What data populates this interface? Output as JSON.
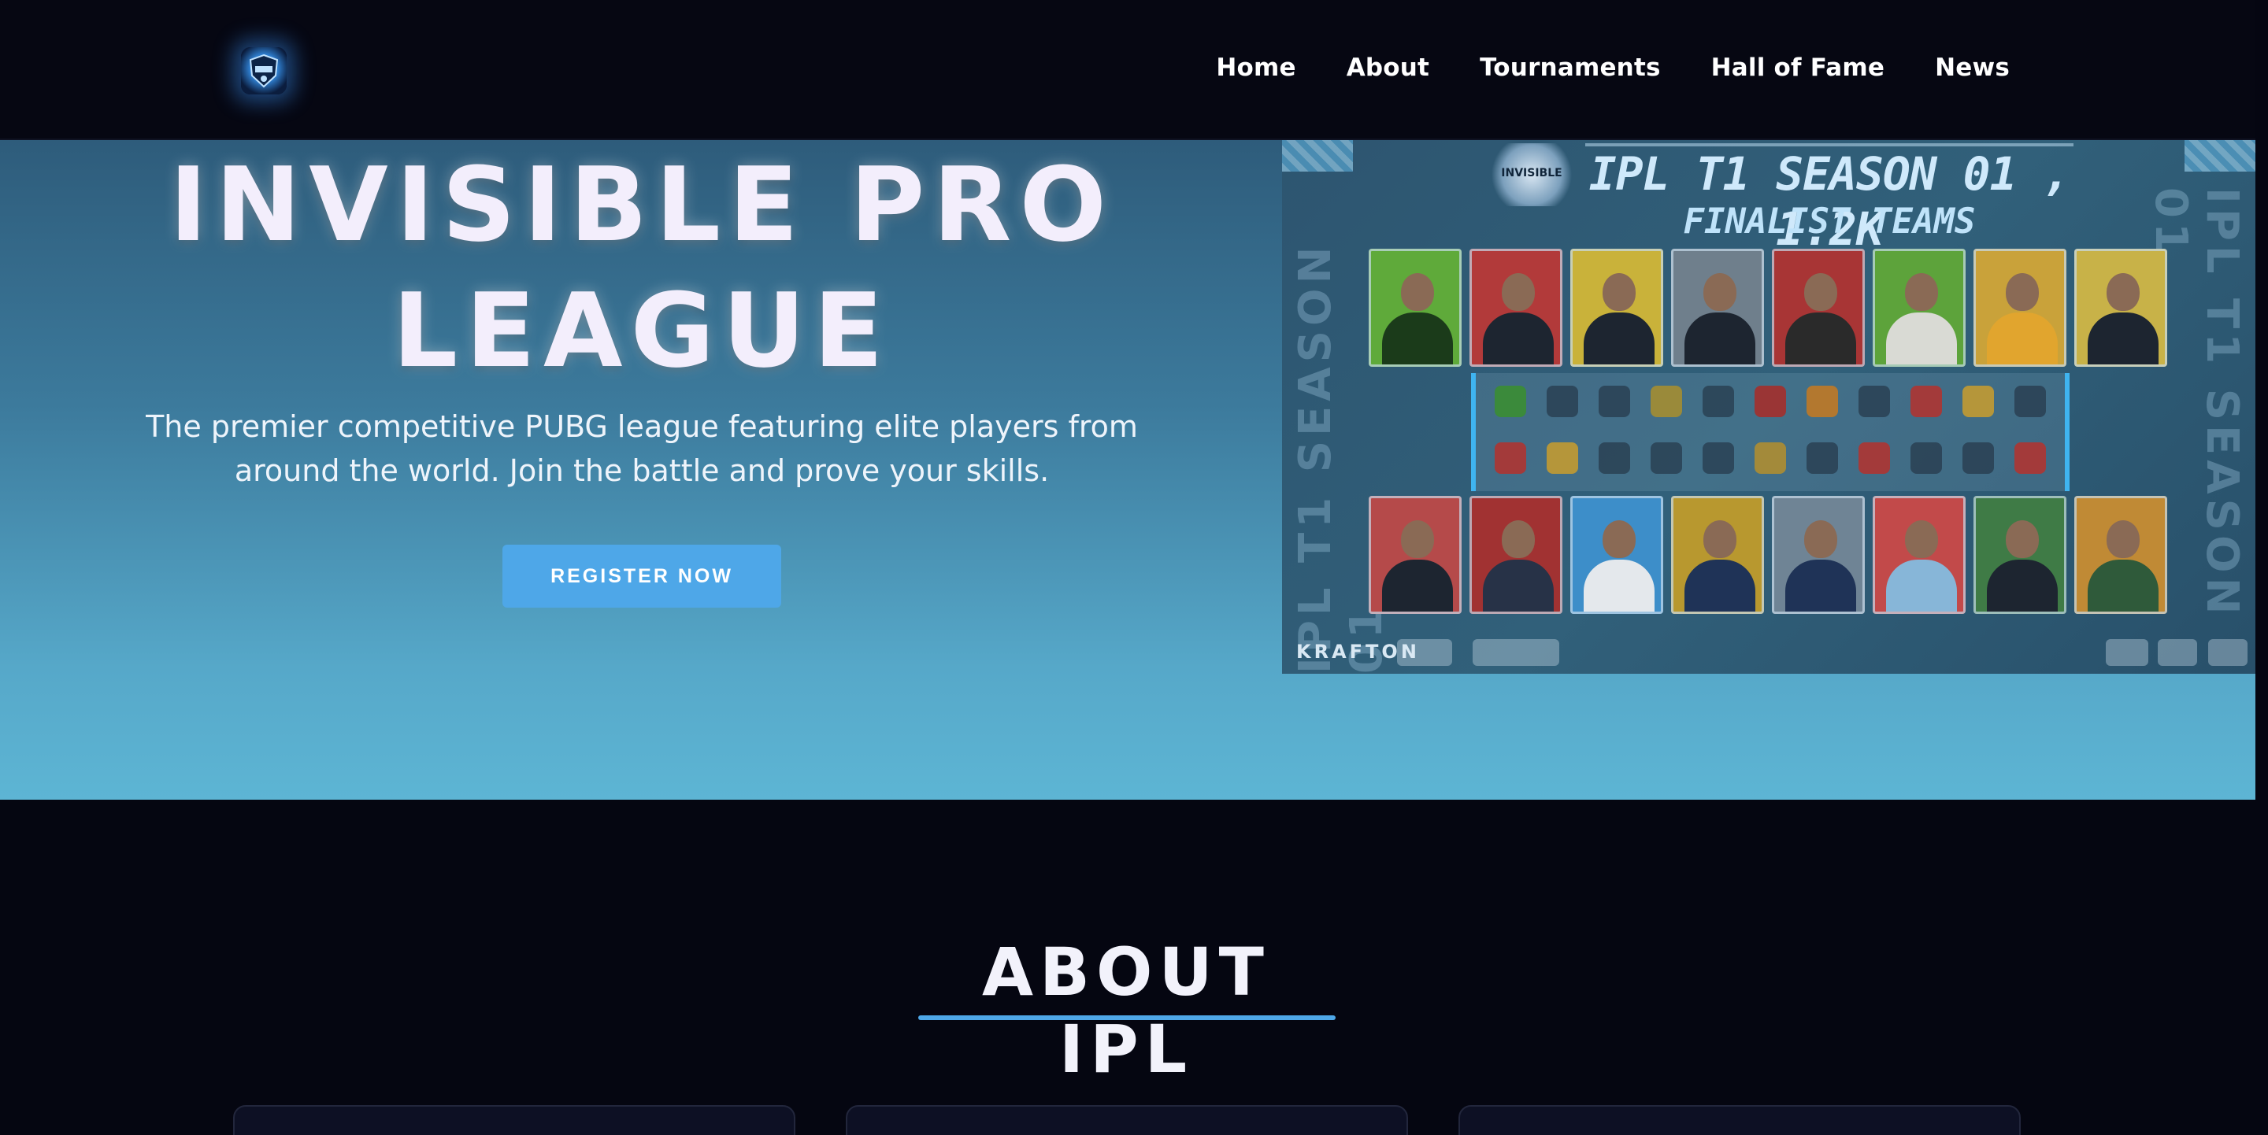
{
  "nav": {
    "logo_icon": "ipl-shield-logo-icon",
    "links": [
      "Home",
      "About",
      "Tournaments",
      "Hall of Fame",
      "News"
    ]
  },
  "hero": {
    "title_line1": "INVISIBLE PRO",
    "title_line2": "LEAGUE",
    "subtitle_line1": "The premier competitive PUBG league featuring elite players from",
    "subtitle_line2": "around the world. Join the battle and prove your skills.",
    "cta_label": "REGISTER NOW"
  },
  "poster": {
    "title": "IPL T1 SEASON 01 , 1.2K",
    "subtitle": "FINALIST TEAMS",
    "badge": "INVISIBLE",
    "side_text": "IPL T1 SEASON 01",
    "sponsor": "KRAFTON"
  },
  "about": {
    "title": "ABOUT IPL"
  },
  "colors": {
    "accent": "#4ea7e8",
    "background": "#050611",
    "hero_top": "#2e5c7b",
    "hero_bottom": "#5db5d4"
  }
}
